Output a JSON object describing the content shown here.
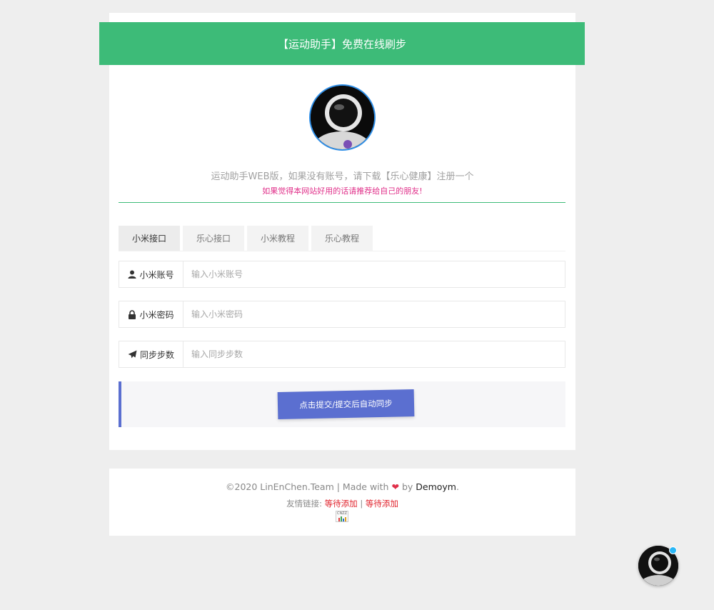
{
  "header": {
    "title": "【运动助手】免费在线刷步"
  },
  "intro": {
    "text": "运动助手WEB版，如果没有账号，请下载【乐心健康】注册一个",
    "recommend": "如果觉得本网站好用的话请推荐给自己的朋友!"
  },
  "tabs": [
    {
      "label": "小米接口"
    },
    {
      "label": "乐心接口"
    },
    {
      "label": "小米教程"
    },
    {
      "label": "乐心教程"
    }
  ],
  "form": {
    "account": {
      "label": "小米账号",
      "placeholder": "输入小米账号",
      "value": ""
    },
    "password": {
      "label": "小米密码",
      "placeholder": "输入小米密码",
      "value": ""
    },
    "steps": {
      "label": "同步步数",
      "placeholder": "输入同步步数",
      "value": ""
    },
    "submit_label": "点击提交/提交后自动同步"
  },
  "footer": {
    "copyright_prefix": "©2020 LinEnChen.Team | Made with",
    "by": "by",
    "brand": "Demoym",
    "period": ".",
    "links_label": "友情链接:",
    "link1": "等待添加",
    "separator": "|",
    "link2": "等待添加",
    "badge": "CNZZ"
  },
  "colors": {
    "accent": "#3dbb78",
    "button": "#5b6fd0",
    "recommend": "#e0308a",
    "link": "#e0202a",
    "heart": "#e0304a"
  },
  "icons": [
    "user-icon",
    "lock-icon",
    "paper-plane-icon",
    "heart-icon",
    "cnzz-badge-icon"
  ]
}
